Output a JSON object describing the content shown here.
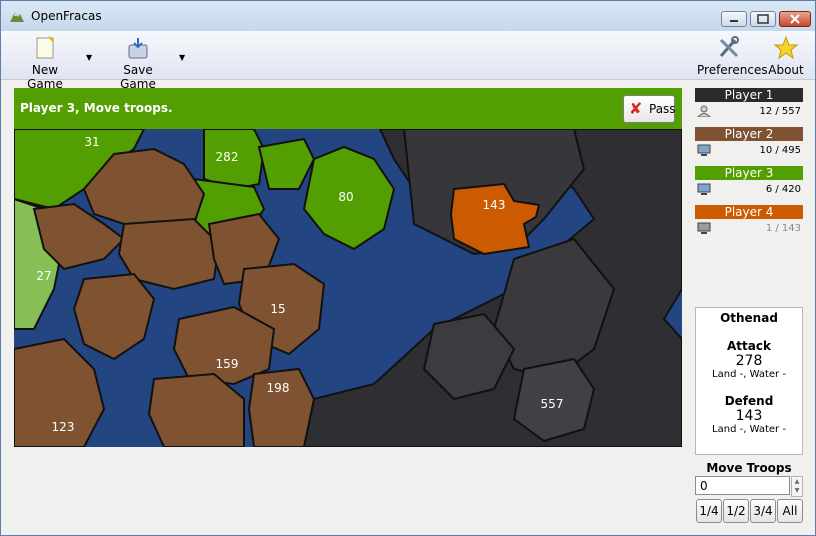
{
  "window": {
    "title": "OpenFracas"
  },
  "toolbar": {
    "new_game": "New Game",
    "save_game": "Save Game",
    "preferences": "Preferences",
    "about": "About"
  },
  "status": {
    "message": "Player 3, Move troops.",
    "pass_label": "Pass",
    "color": "#539e00"
  },
  "map": {
    "territories": [
      {
        "label": "31",
        "owner": "Player 3"
      },
      {
        "label": "282",
        "owner": "Player 3"
      },
      {
        "label": "80",
        "owner": "Player 3"
      },
      {
        "label": "143",
        "owner": "Player 4"
      },
      {
        "label": "27",
        "owner": "Player 3"
      },
      {
        "label": "15",
        "owner": "Player 2"
      },
      {
        "label": "159",
        "owner": "Player 2"
      },
      {
        "label": "198",
        "owner": "Player 2"
      },
      {
        "label": "123",
        "owner": "Player 2"
      },
      {
        "label": "557",
        "owner": "Player 1"
      }
    ],
    "colors": {
      "water": "#234683",
      "player1": "#2f2f33",
      "player2": "#7f5232",
      "player3": "#539e00",
      "player4": "#cc5a00"
    }
  },
  "players": [
    {
      "name": "Player 1",
      "color": "#2b2b2b",
      "count": "12 / 557",
      "icon": "human-icon"
    },
    {
      "name": "Player 2",
      "color": "#7f5232",
      "count": "10 / 495",
      "icon": "computer-icon"
    },
    {
      "name": "Player 3",
      "color": "#539e00",
      "count": "6 / 420",
      "icon": "computer-icon"
    },
    {
      "name": "Player 4",
      "color": "#cc5a00",
      "count": "1 / 143",
      "icon": "computer-icon"
    }
  ],
  "info": {
    "territory": "Othenad",
    "attack_label": "Attack",
    "attack_value": "278",
    "attack_sub": "Land -, Water -",
    "defend_label": "Defend",
    "defend_value": "143",
    "defend_sub": "Land -, Water -"
  },
  "move": {
    "title": "Move Troops",
    "value": "0",
    "buttons": [
      "1/4",
      "1/2",
      "3/4",
      "All"
    ]
  }
}
